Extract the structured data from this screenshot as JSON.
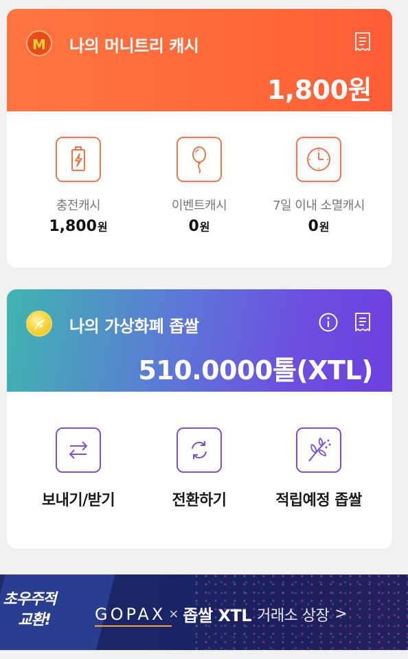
{
  "cash_card": {
    "title": "나의 머니트리 캐시",
    "amount": "1,800원",
    "logo_text": "M",
    "accent_color": "#ff6b3d",
    "items": [
      {
        "label": "충전캐시",
        "value": "1,800",
        "unit": "원",
        "icon": "battery-charge-icon"
      },
      {
        "label": "이벤트캐시",
        "value": "0",
        "unit": "원",
        "icon": "balloon-icon"
      },
      {
        "label": "7일 이내 소멸캐시",
        "value": "0",
        "unit": "원",
        "icon": "clock-icon"
      }
    ]
  },
  "coin_card": {
    "title": "나의 가상화폐 좁쌀",
    "amount": "510.0000톨(XTL)",
    "accent_color": "#6d3fe0",
    "items": [
      {
        "label": "보내기/받기",
        "icon": "transfer-arrows-icon"
      },
      {
        "label": "전환하기",
        "icon": "convert-cycle-icon"
      },
      {
        "label": "적립예정 좁쌀",
        "icon": "sprout-icon"
      }
    ]
  },
  "banner": {
    "promo_line1": "초우주적",
    "promo_line2": "교환!",
    "brand": "GOPAX",
    "times": "×",
    "headline_main": "좁쌀 XTL",
    "headline_sub": "거래소 상장",
    "arrow": ">"
  }
}
